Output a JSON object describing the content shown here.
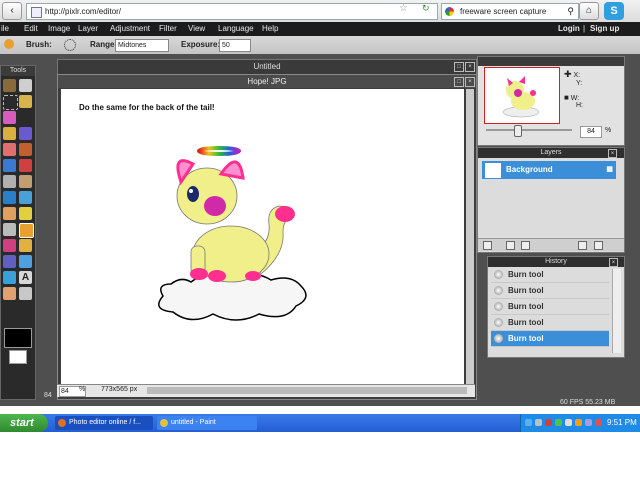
{
  "browser": {
    "url": "http://pixlr.com/editor/",
    "search_text": "freeware screen capture",
    "skype_label": "S"
  },
  "menu": {
    "items": [
      "ile",
      "Edit",
      "Image",
      "Layer",
      "Adjustment",
      "Filter",
      "View",
      "Language",
      "Help"
    ],
    "login": "Login",
    "separator": "|",
    "signup": "Sign up"
  },
  "options": {
    "brush_label": "Brush:",
    "range_label": "Range:",
    "range_value": "Midtones",
    "exposure_label": "Exposure:",
    "exposure_value": "50"
  },
  "tools": {
    "title": "Tools"
  },
  "documents": {
    "untitled_title": "Untitled",
    "active_title": "Hope! JPG",
    "caption": "Do the same for the back of the tail!",
    "zoom": "84",
    "zoom_unit": "%",
    "dimensions": "773x565 px",
    "outer_zoom": "84"
  },
  "navigator": {
    "x_label": "X:",
    "y_label": "Y:",
    "w_label": "W:",
    "h_label": "H:",
    "zoom": "84",
    "zoom_unit": "%"
  },
  "layers": {
    "title": "Layers",
    "items": [
      {
        "name": "Background"
      }
    ]
  },
  "history": {
    "title": "History",
    "items": [
      "Burn tool",
      "Burn tool",
      "Burn tool",
      "Burn tool",
      "Burn tool"
    ],
    "selected_index": 4
  },
  "status": {
    "fps": "60 FPS 55.23 MB"
  },
  "taskbar": {
    "start_label": "start",
    "tasks": [
      "Photo editor online / f...",
      "untitled - Paint"
    ],
    "clock": "9:51 PM"
  },
  "colors": {
    "accent": "#3a8fd8",
    "panel_dark": "#2f2f2f",
    "workspace": "#4f4f4f",
    "taskbar": "#245ed6",
    "start_green": "#2e8a2e"
  }
}
